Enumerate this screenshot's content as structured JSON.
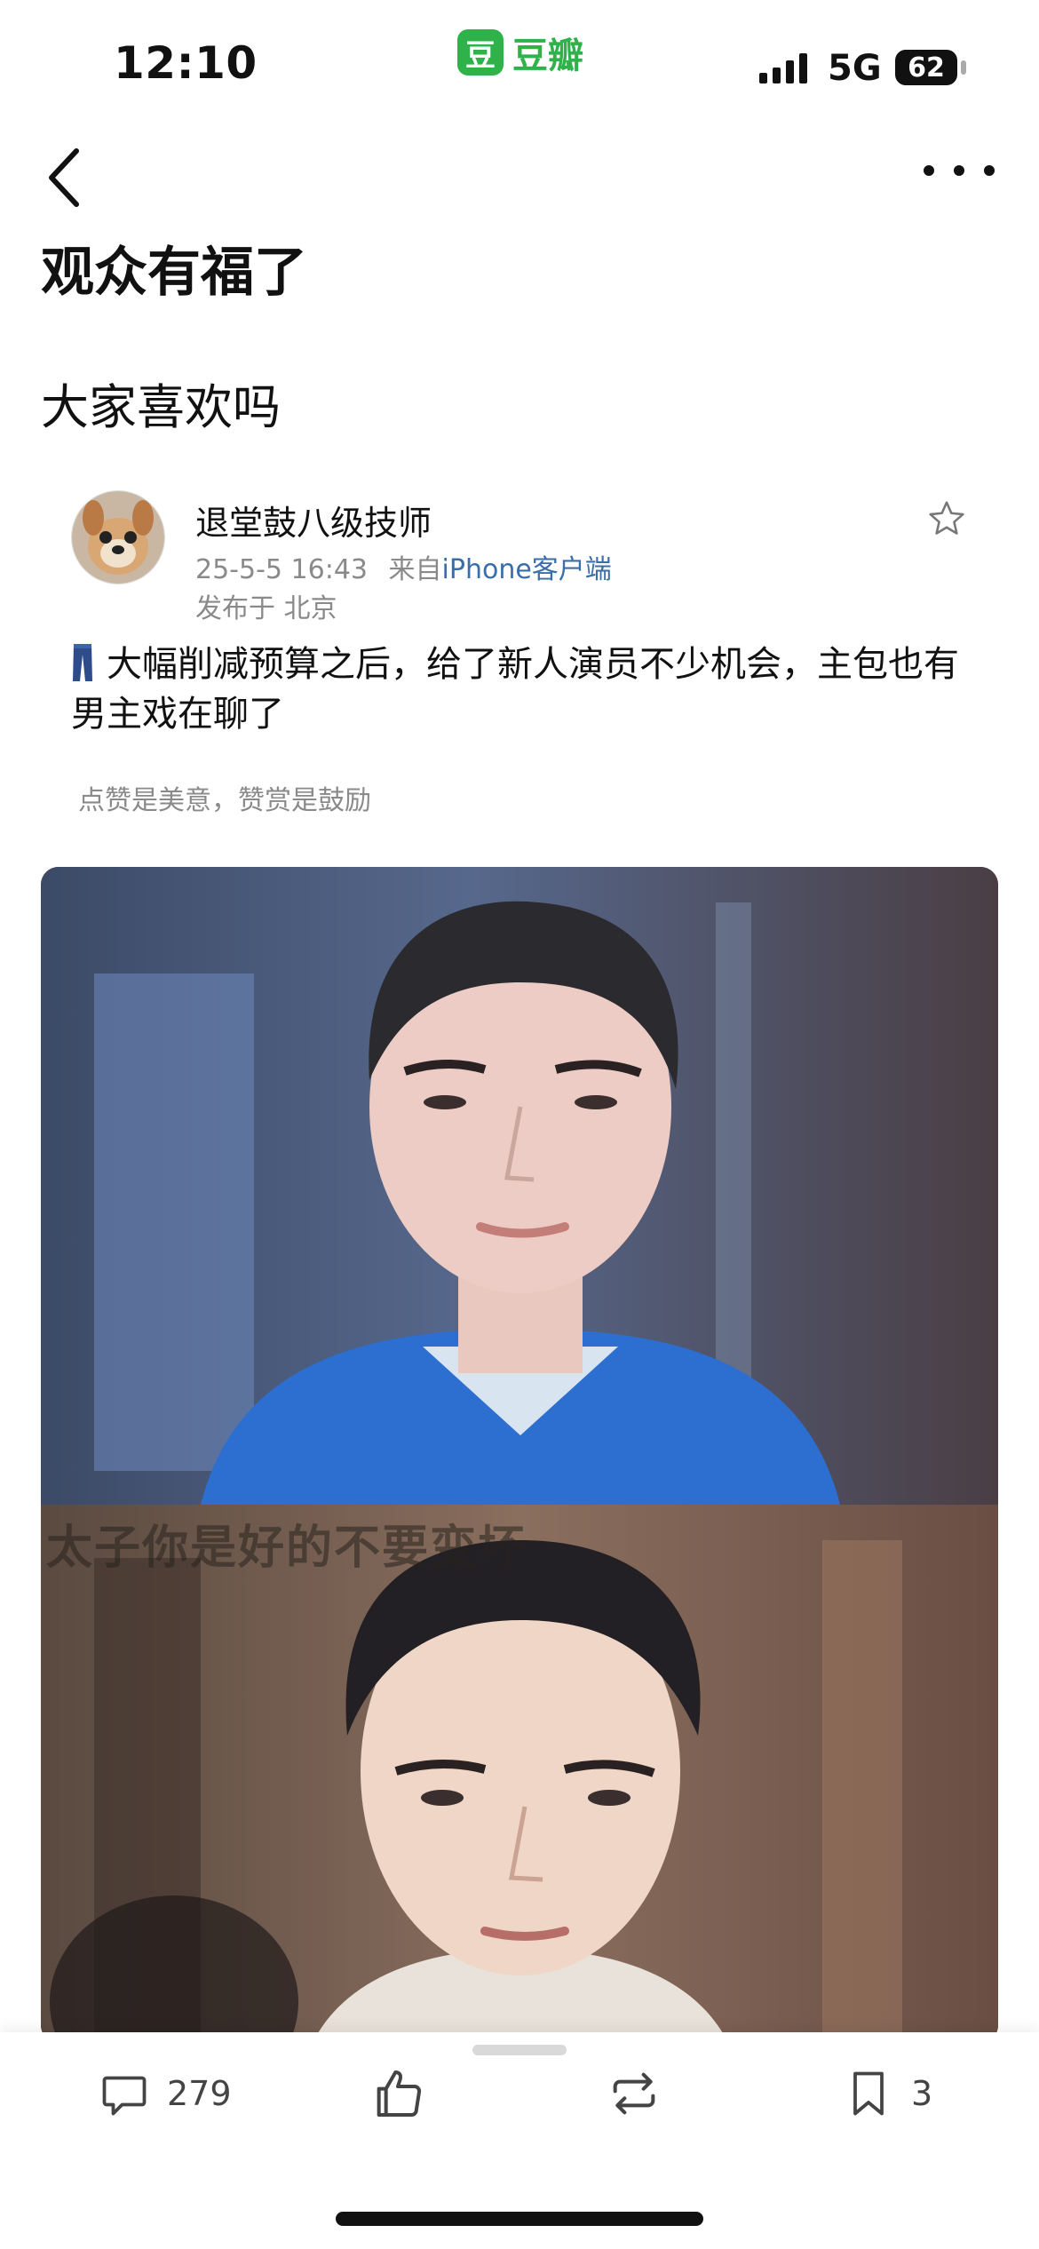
{
  "status_bar": {
    "time": "12:10",
    "app_name": "豆瓣",
    "app_logo_char": "豆",
    "network": "5G",
    "battery": "62",
    "signal_icon": "signal-bars-icon",
    "brand_color": "#2fb24a"
  },
  "nav": {
    "back_icon": "chevron-left-icon",
    "more_icon": "more-dots-icon"
  },
  "post": {
    "title": "观众有福了",
    "subtitle": "大家喜欢吗",
    "author": {
      "name": "退堂鼓八级技师",
      "date": "25-5-5 16:43",
      "source_prefix": "来自",
      "source_client": "iPhone客户端",
      "location": "发布于 北京"
    },
    "body": "大幅削减预算之后，给了新人演员不少机会，主包也有男主戏在聊了",
    "reward_text": "点赞是美意，赞赏是鼓励",
    "images": [
      {
        "name": "image-blue-shirt"
      },
      {
        "name": "image-period-drama",
        "caption": "太子你是好的不要变坏"
      }
    ]
  },
  "actions": {
    "comment_count": "279",
    "collect_count": "3",
    "icons": [
      "comment-icon",
      "like-icon",
      "repost-icon",
      "collect-icon"
    ]
  }
}
